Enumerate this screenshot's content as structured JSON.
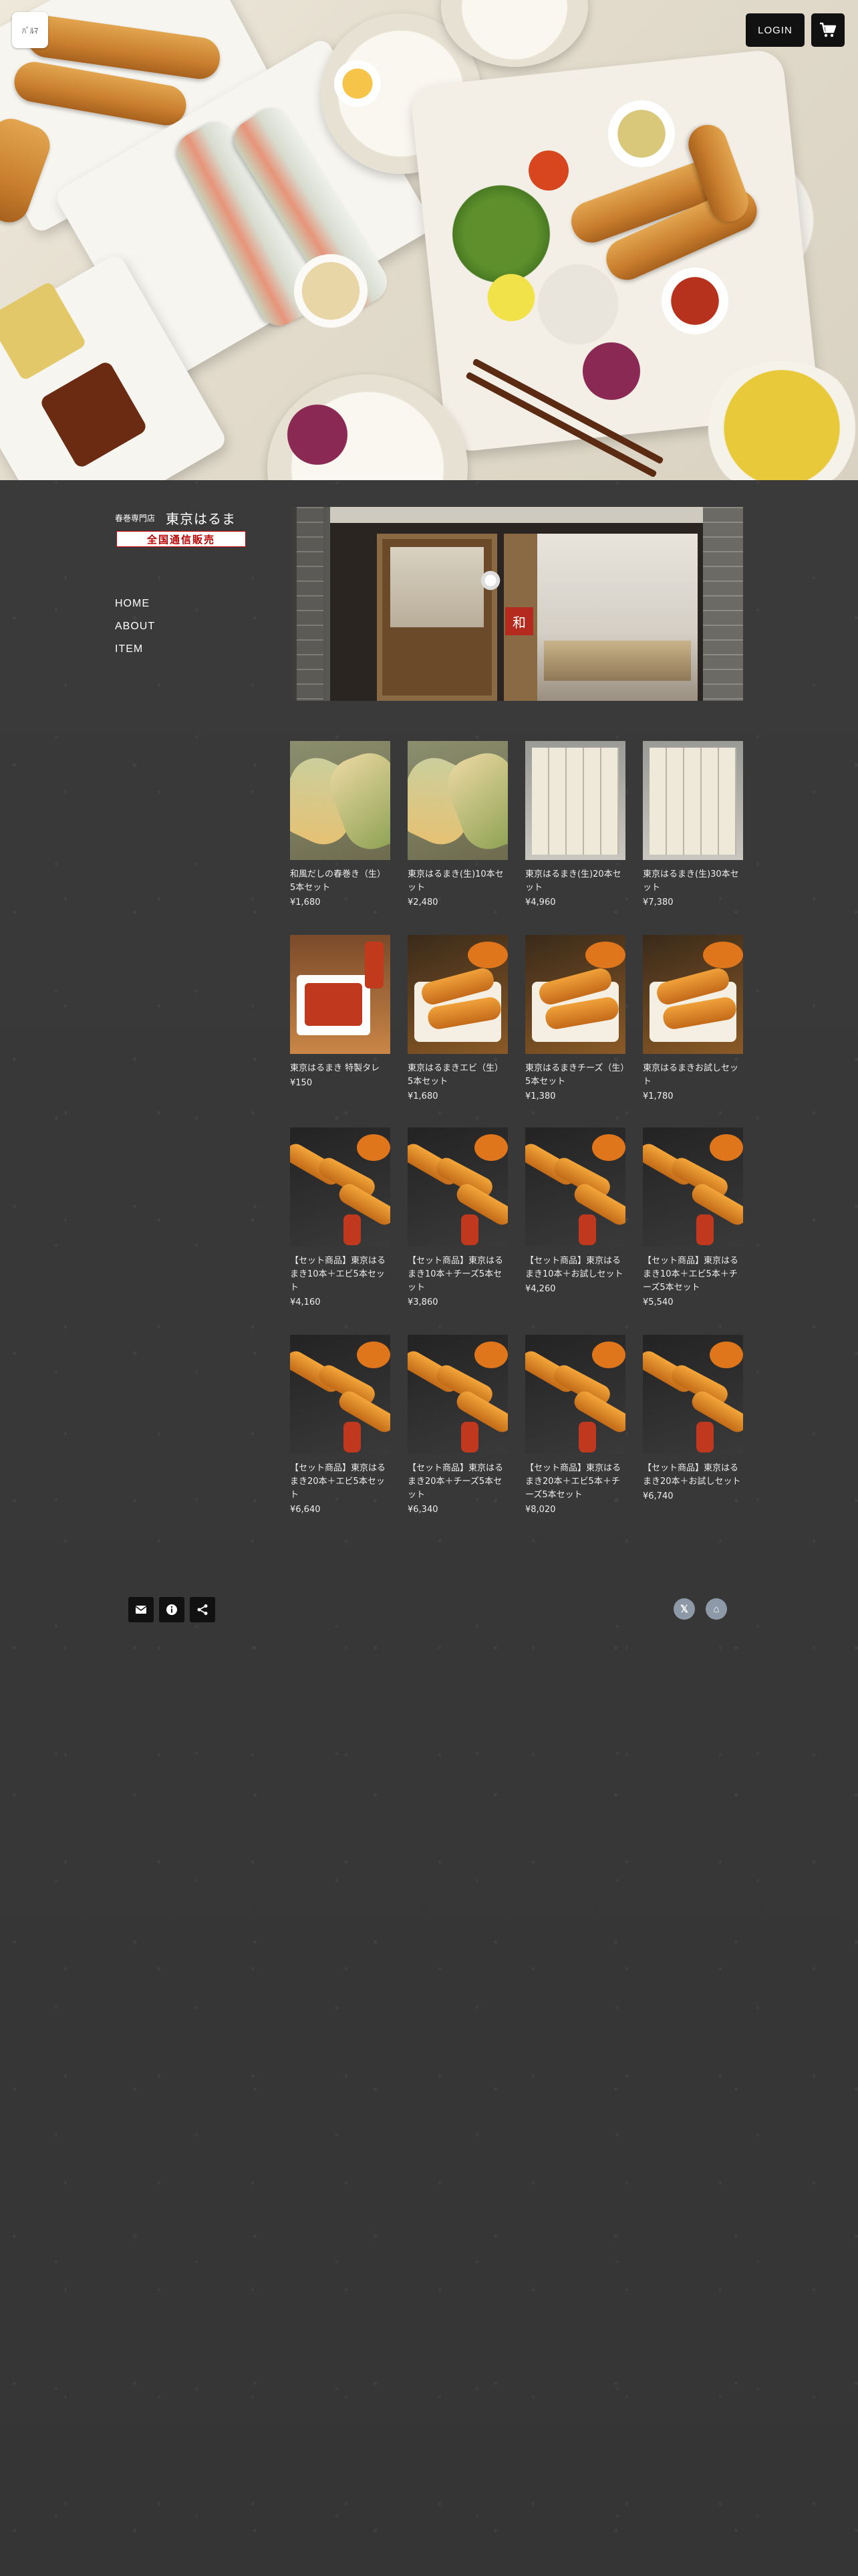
{
  "header": {
    "site_logo_text": "ﾊﾟﾙﾏ",
    "login_label": "LOGIN"
  },
  "brand": {
    "logo_sub": "春巻専門店",
    "logo_main": "東京はるまき",
    "logo_badge": "全国通信販売",
    "badge_color": "#b00000"
  },
  "nav": [
    {
      "label": "HOME"
    },
    {
      "label": "ABOUT"
    },
    {
      "label": "ITEM"
    }
  ],
  "products": [
    {
      "name": "和風だしの春巻き（生）5本セット",
      "price": "¥1,680",
      "thumb": "roll"
    },
    {
      "name": "東京はるまき(生)10本セット",
      "price": "¥2,480",
      "thumb": "roll"
    },
    {
      "name": "東京はるまき(生)20本セット",
      "price": "¥4,960",
      "thumb": "tray"
    },
    {
      "name": "東京はるまき(生)30本セット",
      "price": "¥7,380",
      "thumb": "tray"
    },
    {
      "name": "東京はるまき 特製タレ",
      "price": "¥150",
      "thumb": "sauce"
    },
    {
      "name": "東京はるまきエビ（生）5本セット",
      "price": "¥1,680",
      "thumb": "fried"
    },
    {
      "name": "東京はるまきチーズ（生）5本セット",
      "price": "¥1,380",
      "thumb": "fried"
    },
    {
      "name": "東京はるまきお試しセット",
      "price": "¥1,780",
      "thumb": "fried"
    },
    {
      "name": "【セット商品】東京はるまき10本＋エビ5本セット",
      "price": "¥4,160",
      "thumb": "set"
    },
    {
      "name": "【セット商品】東京はるまき10本＋チーズ5本セット",
      "price": "¥3,860",
      "thumb": "set"
    },
    {
      "name": "【セット商品】東京はるまき10本＋お試しセット",
      "price": "¥4,260",
      "thumb": "set"
    },
    {
      "name": "【セット商品】東京はるまき10本＋エビ5本＋チーズ5本セット",
      "price": "¥5,540",
      "thumb": "set"
    },
    {
      "name": "【セット商品】東京はるまき20本＋エビ5本セット",
      "price": "¥6,640",
      "thumb": "set"
    },
    {
      "name": "【セット商品】東京はるまき20本＋チーズ5本セット",
      "price": "¥6,340",
      "thumb": "set"
    },
    {
      "name": "【セット商品】東京はるまき20本＋エビ5本＋チーズ5本セット",
      "price": "¥8,020",
      "thumb": "set"
    },
    {
      "name": "【セット商品】東京はるまき20本＋お試しセット",
      "price": "¥6,740",
      "thumb": "set"
    }
  ],
  "footer": {
    "icons": [
      "mail-icon",
      "info-icon",
      "share-icon"
    ],
    "social": [
      {
        "name": "x-icon",
        "glyph": "𝕏"
      },
      {
        "name": "home-icon",
        "glyph": "⌂"
      }
    ]
  }
}
